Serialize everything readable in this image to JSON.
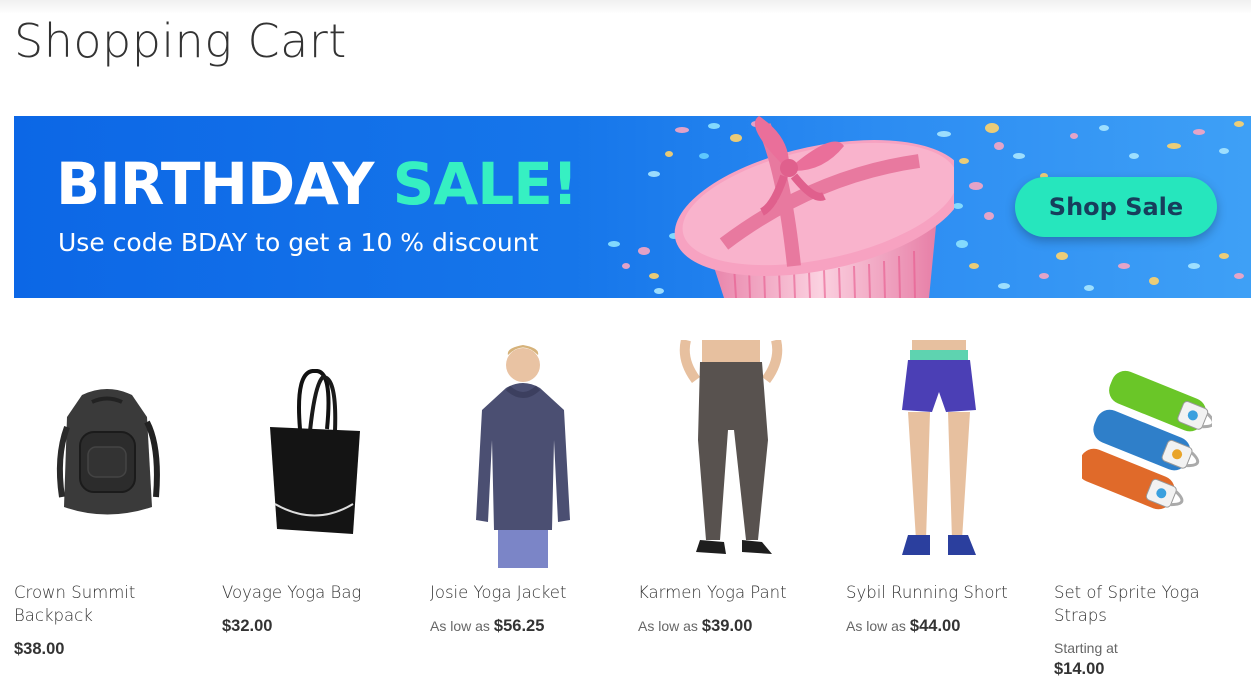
{
  "page": {
    "title": "Shopping Cart"
  },
  "banner": {
    "headline_white": "BIRTHDAY",
    "headline_accent": "SALE!",
    "subtext": "Use code BDAY to get a 10 % discount",
    "cta_label": "Shop Sale",
    "colors": {
      "background": "#1676ea",
      "accent": "#36f0c2",
      "cta": "#26e6bd",
      "gift": "#f28fb4"
    }
  },
  "products": [
    {
      "name": "Crown Summit Backpack",
      "price_prefix": "",
      "price": "$38.00",
      "icon": "backpack-image"
    },
    {
      "name": "Voyage Yoga Bag",
      "price_prefix": "",
      "price": "$32.00",
      "icon": "tote-bag-image"
    },
    {
      "name": "Josie Yoga Jacket",
      "price_prefix": "As low as",
      "price": "$56.25",
      "icon": "jacket-image"
    },
    {
      "name": "Karmen Yoga Pant",
      "price_prefix": "As low as",
      "price": "$39.00",
      "icon": "pants-image"
    },
    {
      "name": "Sybil Running Short",
      "price_prefix": "As low as",
      "price": "$44.00",
      "icon": "shorts-image"
    },
    {
      "name": "Set of Sprite Yoga Straps",
      "price_prefix": "Starting at",
      "price": "$14.00",
      "icon": "yoga-straps-image"
    }
  ]
}
